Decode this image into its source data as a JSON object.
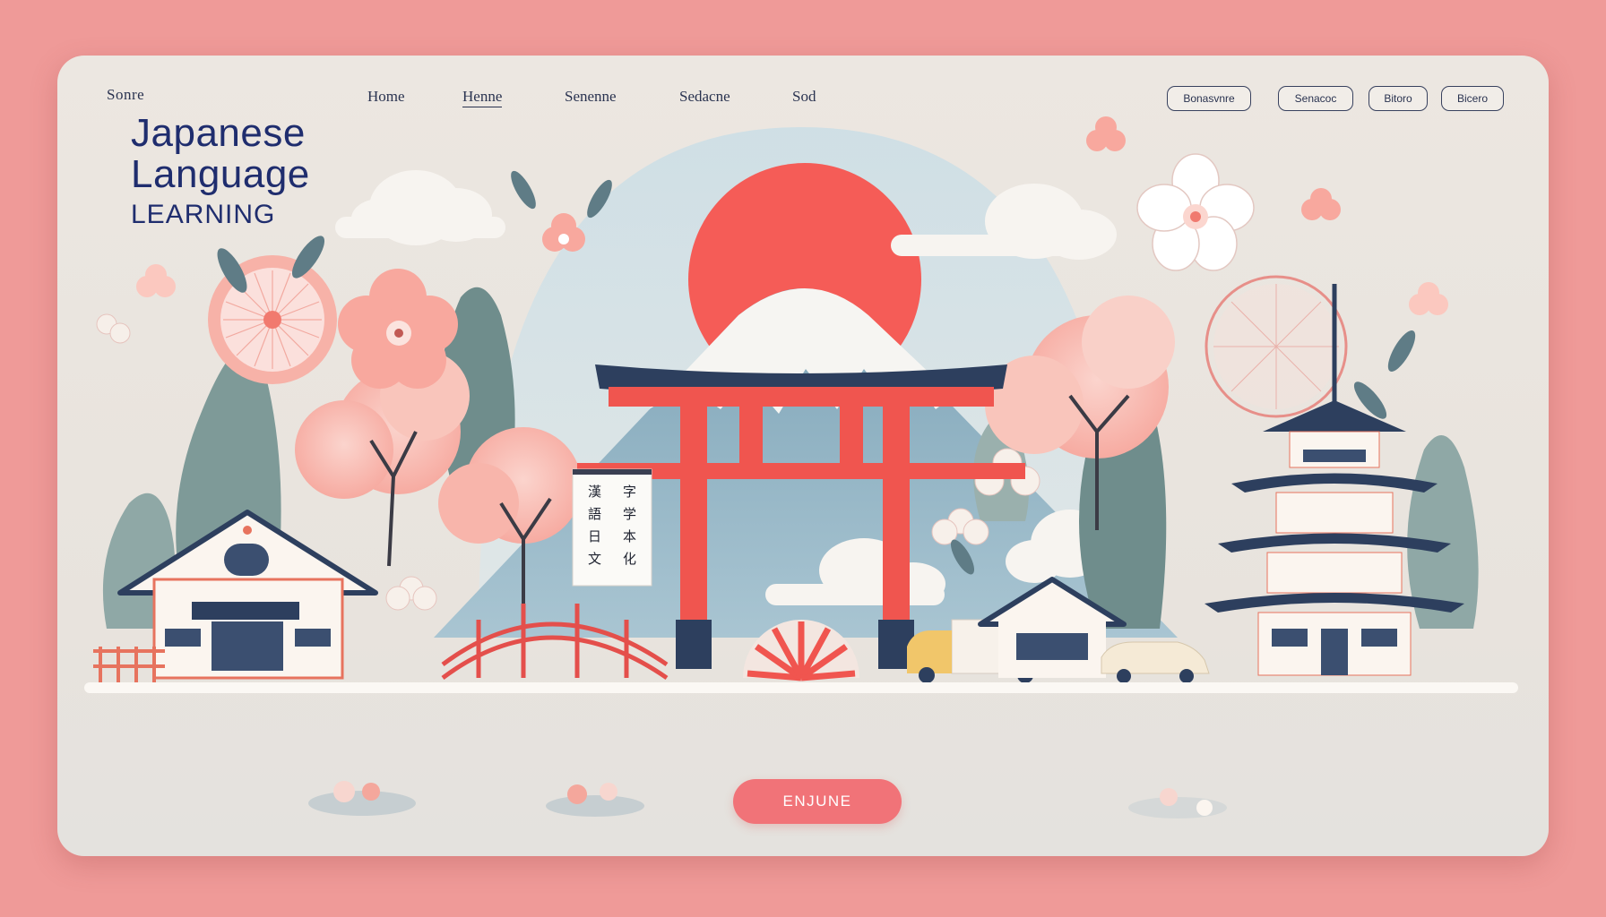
{
  "header": {
    "logo": "Sonre",
    "nav": [
      "Home",
      "Henne",
      "Senenne",
      "Sedacne",
      "Sod"
    ],
    "buttons": [
      "Bonasvnre",
      "Senacoc",
      "Bitoro",
      "Bicero"
    ]
  },
  "hero": {
    "title_line1": "Japanese",
    "title_line2": "Language",
    "title_line3": "Learning",
    "signboard_chars": [
      "漢",
      "字",
      "語",
      "学",
      "日",
      "本",
      "文",
      "化"
    ],
    "cta_label": "ENJUNE"
  },
  "colors": {
    "background": "#ef9a98",
    "card": "#ece7e1",
    "accent_red": "#f0514f",
    "navy": "#1f2d6e",
    "button_pink": "#f17378"
  }
}
